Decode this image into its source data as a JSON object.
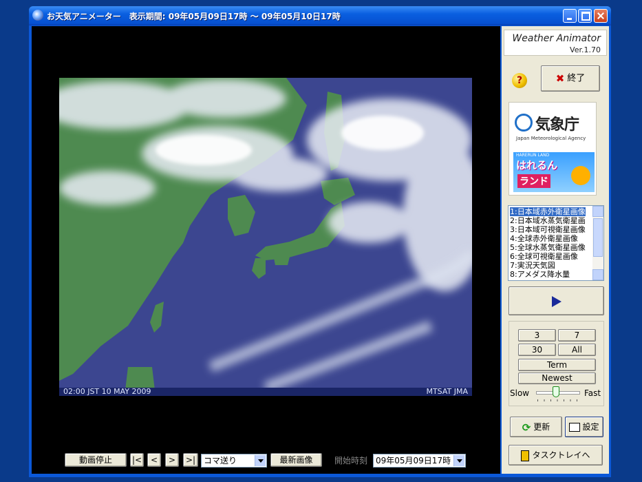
{
  "window": {
    "title": "お天気アニメーター　表示期間: 09年05月09日17時 ～ 09年05月10日17時"
  },
  "image": {
    "caption_left": "02:00 JST 10 MAY 2009",
    "caption_right": "MTSAT JMA"
  },
  "bottombar": {
    "stop_label": "動画停止",
    "first_label": "|<",
    "prev_label": "<",
    "next_label": ">",
    "last_label": ">|",
    "mode_value": "コマ送り",
    "latest_label": "最新画像",
    "start_time_label": "開始時刻",
    "start_time_value": "09年05月09日17時"
  },
  "side": {
    "app_name": "Weather Animator",
    "version": "Ver.1.70",
    "exit_label": "終了",
    "jma_text": "気象庁",
    "jma_sub": "Japan Meteorological Agency",
    "hare_small": "HARERUN LAND",
    "hare_line1": "はれるん",
    "hare_line2": "ランド",
    "list_items": [
      "1:日本域赤外衛星画像",
      "2:日本域水蒸気衛星画",
      "3:日本域可視衛星画像",
      "4:全球赤外衛星画像",
      "5:全球水蒸気衛星画像",
      "6:全球可視衛星画像",
      "7:実況天気図",
      "8:アメダス降水量"
    ],
    "selected_index": 0,
    "range_buttons": [
      "3",
      "7",
      "30",
      "All"
    ],
    "term_label": "Term",
    "newest_label": "Newest",
    "slow_label": "Slow",
    "fast_label": "Fast",
    "speed_fraction": 0.45,
    "refresh_label": "更新",
    "settings_label": "設定",
    "tray_label": "タスクトレイへ"
  },
  "colors": {
    "titlebar": "#0a5fe0",
    "selection": "#316ac5",
    "ocean": "#3a4488",
    "land": "#4a8a4a",
    "play_arrow": "#1a2a9a"
  }
}
